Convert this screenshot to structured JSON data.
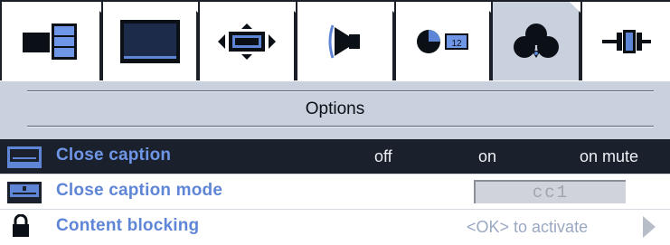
{
  "tabs": [
    {
      "icon": "picture-in-picture-icon",
      "active": false
    },
    {
      "icon": "screen-icon",
      "active": false
    },
    {
      "icon": "screen-size-icon",
      "active": false
    },
    {
      "icon": "sound-icon",
      "active": false
    },
    {
      "icon": "clock-icon",
      "active": false,
      "badge": "12"
    },
    {
      "icon": "options-icon",
      "active": true
    },
    {
      "icon": "connection-icon",
      "active": false
    }
  ],
  "panel": {
    "title": "Options"
  },
  "rows": {
    "close_caption": {
      "label": "Close caption",
      "options": [
        "off",
        "on",
        "on mute"
      ]
    },
    "close_caption_mode": {
      "label": "Close caption mode",
      "value": "cc1"
    },
    "content_blocking": {
      "label": "Content blocking",
      "hint": "<OK> to activate"
    }
  },
  "colors": {
    "accent": "#5f86d6",
    "selected_row": "#1a212d",
    "tab_active": "#c9d1de"
  }
}
